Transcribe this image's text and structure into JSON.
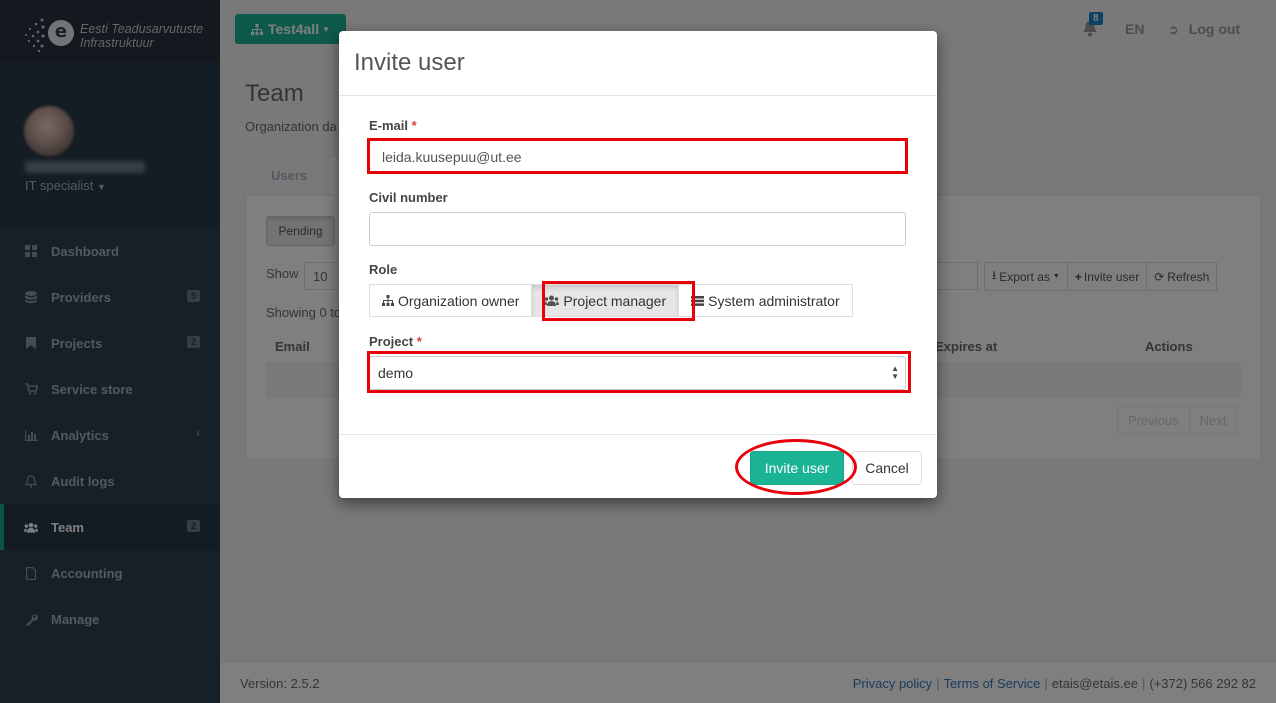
{
  "brand": {
    "line1": "Eesti Teadusarvutuste",
    "line2": "Infrastruktuur",
    "logo_letter": "e"
  },
  "profile": {
    "role": "IT specialist"
  },
  "sidebar": {
    "items": [
      {
        "label": "Dashboard",
        "icon": "dashboard-icon",
        "badge": null
      },
      {
        "label": "Providers",
        "icon": "database-icon",
        "badge": "5"
      },
      {
        "label": "Projects",
        "icon": "bookmark-icon",
        "badge": "2"
      },
      {
        "label": "Service store",
        "icon": "cart-icon",
        "badge": null
      },
      {
        "label": "Analytics",
        "icon": "bar-chart-icon",
        "badge": null
      },
      {
        "label": "Audit logs",
        "icon": "bell-icon",
        "badge": null
      },
      {
        "label": "Team",
        "icon": "users-icon",
        "badge": "2"
      },
      {
        "label": "Accounting",
        "icon": "file-icon",
        "badge": null
      },
      {
        "label": "Manage",
        "icon": "wrench-icon",
        "badge": null
      }
    ]
  },
  "topbar": {
    "org_label": "Test4all",
    "notification_count": "8",
    "language": "EN",
    "logout_label": "Log out"
  },
  "page": {
    "title": "Team",
    "subtitle": "Organization da",
    "tabs": [
      {
        "label": "Users"
      }
    ],
    "pending_label": "Pending",
    "show_label": "Show",
    "show_value": "10",
    "export_label": "Export as",
    "invite_label": "Invite user",
    "refresh_label": "Refresh",
    "showing_text": "Showing 0 to",
    "columns": {
      "email": "Email",
      "expires": "Expires at",
      "actions": "Actions"
    },
    "pager": {
      "previous": "Previous",
      "next": "Next"
    }
  },
  "footer": {
    "version": "Version: 2.5.2",
    "privacy": "Privacy policy",
    "terms": "Terms of Service",
    "email": "etais@etais.ee",
    "phone": "(+372) 566 292 82"
  },
  "modal": {
    "title": "Invite user",
    "email_label": "E-mail",
    "email_value": "leida.kuusepuu@ut.ee",
    "civil_label": "Civil number",
    "civil_value": "",
    "role_label": "Role",
    "roles": [
      {
        "label": "Organization owner",
        "icon": "sitemap-icon",
        "selected": false
      },
      {
        "label": "Project manager",
        "icon": "users-icon",
        "selected": true
      },
      {
        "label": "System administrator",
        "icon": "server-icon",
        "selected": false
      }
    ],
    "project_label": "Project",
    "project_value": "demo",
    "required_mark": "*",
    "invite_button": "Invite user",
    "cancel_button": "Cancel"
  },
  "colors": {
    "accent": "#1ab394",
    "sidebar": "#2f4050",
    "highlight": "#e8000b"
  }
}
